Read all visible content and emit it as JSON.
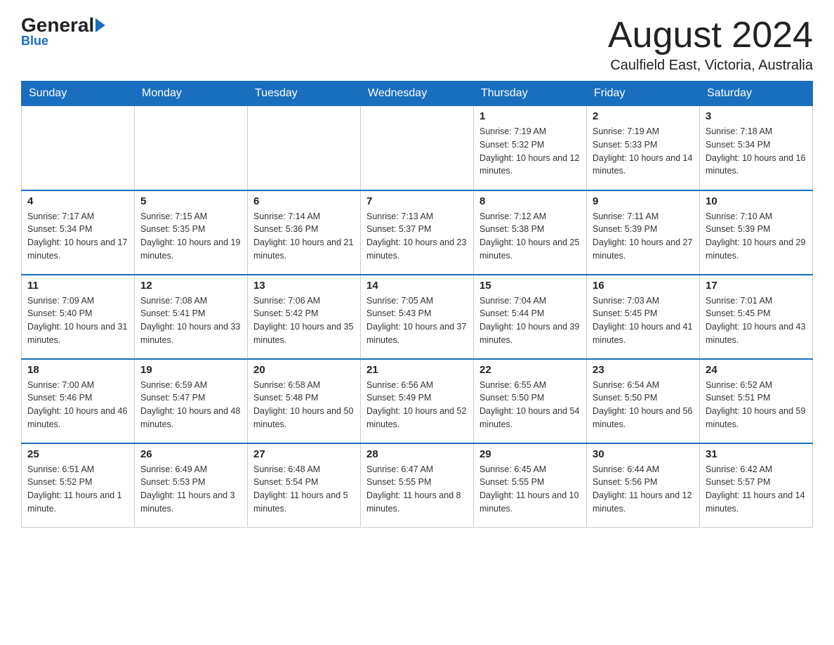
{
  "header": {
    "logo_main": "General",
    "logo_blue": "Blue",
    "month_title": "August 2024",
    "location": "Caulfield East, Victoria, Australia"
  },
  "weekdays": [
    "Sunday",
    "Monday",
    "Tuesday",
    "Wednesday",
    "Thursday",
    "Friday",
    "Saturday"
  ],
  "weeks": [
    [
      {
        "num": "",
        "sunrise": "",
        "sunset": "",
        "daylight": ""
      },
      {
        "num": "",
        "sunrise": "",
        "sunset": "",
        "daylight": ""
      },
      {
        "num": "",
        "sunrise": "",
        "sunset": "",
        "daylight": ""
      },
      {
        "num": "",
        "sunrise": "",
        "sunset": "",
        "daylight": ""
      },
      {
        "num": "1",
        "sunrise": "Sunrise: 7:19 AM",
        "sunset": "Sunset: 5:32 PM",
        "daylight": "Daylight: 10 hours and 12 minutes."
      },
      {
        "num": "2",
        "sunrise": "Sunrise: 7:19 AM",
        "sunset": "Sunset: 5:33 PM",
        "daylight": "Daylight: 10 hours and 14 minutes."
      },
      {
        "num": "3",
        "sunrise": "Sunrise: 7:18 AM",
        "sunset": "Sunset: 5:34 PM",
        "daylight": "Daylight: 10 hours and 16 minutes."
      }
    ],
    [
      {
        "num": "4",
        "sunrise": "Sunrise: 7:17 AM",
        "sunset": "Sunset: 5:34 PM",
        "daylight": "Daylight: 10 hours and 17 minutes."
      },
      {
        "num": "5",
        "sunrise": "Sunrise: 7:15 AM",
        "sunset": "Sunset: 5:35 PM",
        "daylight": "Daylight: 10 hours and 19 minutes."
      },
      {
        "num": "6",
        "sunrise": "Sunrise: 7:14 AM",
        "sunset": "Sunset: 5:36 PM",
        "daylight": "Daylight: 10 hours and 21 minutes."
      },
      {
        "num": "7",
        "sunrise": "Sunrise: 7:13 AM",
        "sunset": "Sunset: 5:37 PM",
        "daylight": "Daylight: 10 hours and 23 minutes."
      },
      {
        "num": "8",
        "sunrise": "Sunrise: 7:12 AM",
        "sunset": "Sunset: 5:38 PM",
        "daylight": "Daylight: 10 hours and 25 minutes."
      },
      {
        "num": "9",
        "sunrise": "Sunrise: 7:11 AM",
        "sunset": "Sunset: 5:39 PM",
        "daylight": "Daylight: 10 hours and 27 minutes."
      },
      {
        "num": "10",
        "sunrise": "Sunrise: 7:10 AM",
        "sunset": "Sunset: 5:39 PM",
        "daylight": "Daylight: 10 hours and 29 minutes."
      }
    ],
    [
      {
        "num": "11",
        "sunrise": "Sunrise: 7:09 AM",
        "sunset": "Sunset: 5:40 PM",
        "daylight": "Daylight: 10 hours and 31 minutes."
      },
      {
        "num": "12",
        "sunrise": "Sunrise: 7:08 AM",
        "sunset": "Sunset: 5:41 PM",
        "daylight": "Daylight: 10 hours and 33 minutes."
      },
      {
        "num": "13",
        "sunrise": "Sunrise: 7:06 AM",
        "sunset": "Sunset: 5:42 PM",
        "daylight": "Daylight: 10 hours and 35 minutes."
      },
      {
        "num": "14",
        "sunrise": "Sunrise: 7:05 AM",
        "sunset": "Sunset: 5:43 PM",
        "daylight": "Daylight: 10 hours and 37 minutes."
      },
      {
        "num": "15",
        "sunrise": "Sunrise: 7:04 AM",
        "sunset": "Sunset: 5:44 PM",
        "daylight": "Daylight: 10 hours and 39 minutes."
      },
      {
        "num": "16",
        "sunrise": "Sunrise: 7:03 AM",
        "sunset": "Sunset: 5:45 PM",
        "daylight": "Daylight: 10 hours and 41 minutes."
      },
      {
        "num": "17",
        "sunrise": "Sunrise: 7:01 AM",
        "sunset": "Sunset: 5:45 PM",
        "daylight": "Daylight: 10 hours and 43 minutes."
      }
    ],
    [
      {
        "num": "18",
        "sunrise": "Sunrise: 7:00 AM",
        "sunset": "Sunset: 5:46 PM",
        "daylight": "Daylight: 10 hours and 46 minutes."
      },
      {
        "num": "19",
        "sunrise": "Sunrise: 6:59 AM",
        "sunset": "Sunset: 5:47 PM",
        "daylight": "Daylight: 10 hours and 48 minutes."
      },
      {
        "num": "20",
        "sunrise": "Sunrise: 6:58 AM",
        "sunset": "Sunset: 5:48 PM",
        "daylight": "Daylight: 10 hours and 50 minutes."
      },
      {
        "num": "21",
        "sunrise": "Sunrise: 6:56 AM",
        "sunset": "Sunset: 5:49 PM",
        "daylight": "Daylight: 10 hours and 52 minutes."
      },
      {
        "num": "22",
        "sunrise": "Sunrise: 6:55 AM",
        "sunset": "Sunset: 5:50 PM",
        "daylight": "Daylight: 10 hours and 54 minutes."
      },
      {
        "num": "23",
        "sunrise": "Sunrise: 6:54 AM",
        "sunset": "Sunset: 5:50 PM",
        "daylight": "Daylight: 10 hours and 56 minutes."
      },
      {
        "num": "24",
        "sunrise": "Sunrise: 6:52 AM",
        "sunset": "Sunset: 5:51 PM",
        "daylight": "Daylight: 10 hours and 59 minutes."
      }
    ],
    [
      {
        "num": "25",
        "sunrise": "Sunrise: 6:51 AM",
        "sunset": "Sunset: 5:52 PM",
        "daylight": "Daylight: 11 hours and 1 minute."
      },
      {
        "num": "26",
        "sunrise": "Sunrise: 6:49 AM",
        "sunset": "Sunset: 5:53 PM",
        "daylight": "Daylight: 11 hours and 3 minutes."
      },
      {
        "num": "27",
        "sunrise": "Sunrise: 6:48 AM",
        "sunset": "Sunset: 5:54 PM",
        "daylight": "Daylight: 11 hours and 5 minutes."
      },
      {
        "num": "28",
        "sunrise": "Sunrise: 6:47 AM",
        "sunset": "Sunset: 5:55 PM",
        "daylight": "Daylight: 11 hours and 8 minutes."
      },
      {
        "num": "29",
        "sunrise": "Sunrise: 6:45 AM",
        "sunset": "Sunset: 5:55 PM",
        "daylight": "Daylight: 11 hours and 10 minutes."
      },
      {
        "num": "30",
        "sunrise": "Sunrise: 6:44 AM",
        "sunset": "Sunset: 5:56 PM",
        "daylight": "Daylight: 11 hours and 12 minutes."
      },
      {
        "num": "31",
        "sunrise": "Sunrise: 6:42 AM",
        "sunset": "Sunset: 5:57 PM",
        "daylight": "Daylight: 11 hours and 14 minutes."
      }
    ]
  ]
}
